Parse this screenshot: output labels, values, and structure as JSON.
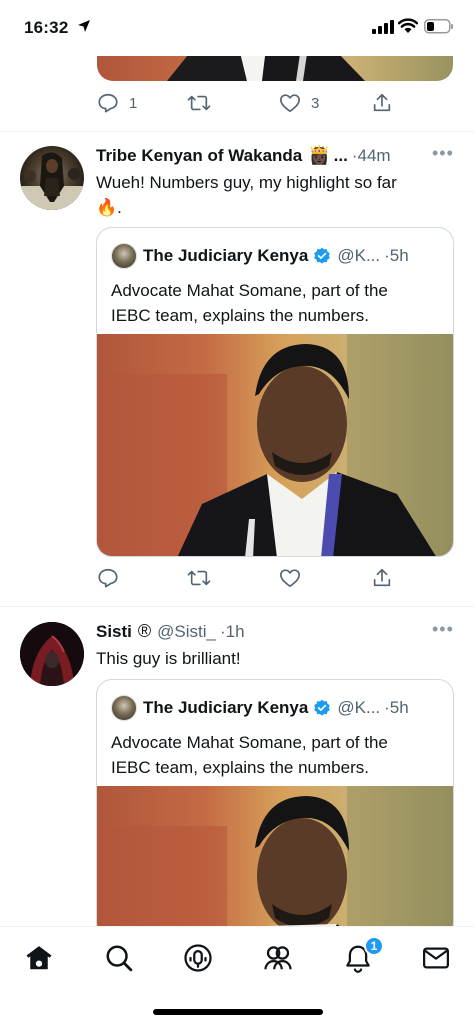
{
  "status_bar": {
    "time": "16:32"
  },
  "prev_tweet": {
    "actions": {
      "reply_count": "1",
      "retweet_count": "",
      "like_count": "3"
    }
  },
  "tweets": [
    {
      "name": "Tribe Kenyan of Wakanda",
      "emoji": "👸🏿",
      "ellipsis": "...",
      "time": "·44m",
      "text_line1": "Wueh! Numbers guy, my highlight so far",
      "text_line2": "🔥.",
      "quote": {
        "name": "The Judiciary Kenya",
        "handle": "@K...",
        "time": "·5h",
        "text_line1": "Advocate Mahat Somane, part of the",
        "text_line2": "IEBC team, explains the numbers."
      },
      "actions": {
        "reply_count": "",
        "retweet_count": "",
        "like_count": ""
      }
    },
    {
      "name": "Sisti",
      "registered": "®",
      "handle": "@Sisti_",
      "time": "·1h",
      "text_line1": "This guy is brilliant!",
      "quote": {
        "name": "The Judiciary Kenya",
        "handle": "@K...",
        "time": "·5h",
        "text_line1": "Advocate Mahat Somane, part of the",
        "text_line2": "IEBC team, explains the numbers."
      }
    }
  ],
  "nav": {
    "items": [
      "home-icon",
      "search-icon",
      "spaces-icon",
      "communities-icon",
      "notifications-icon",
      "messages-icon"
    ],
    "notification_badge": "1"
  },
  "colors": {
    "accent": "#1d9bf0",
    "text": "#0f1419",
    "secondary": "#536471",
    "verified": "#1d9bf0"
  }
}
